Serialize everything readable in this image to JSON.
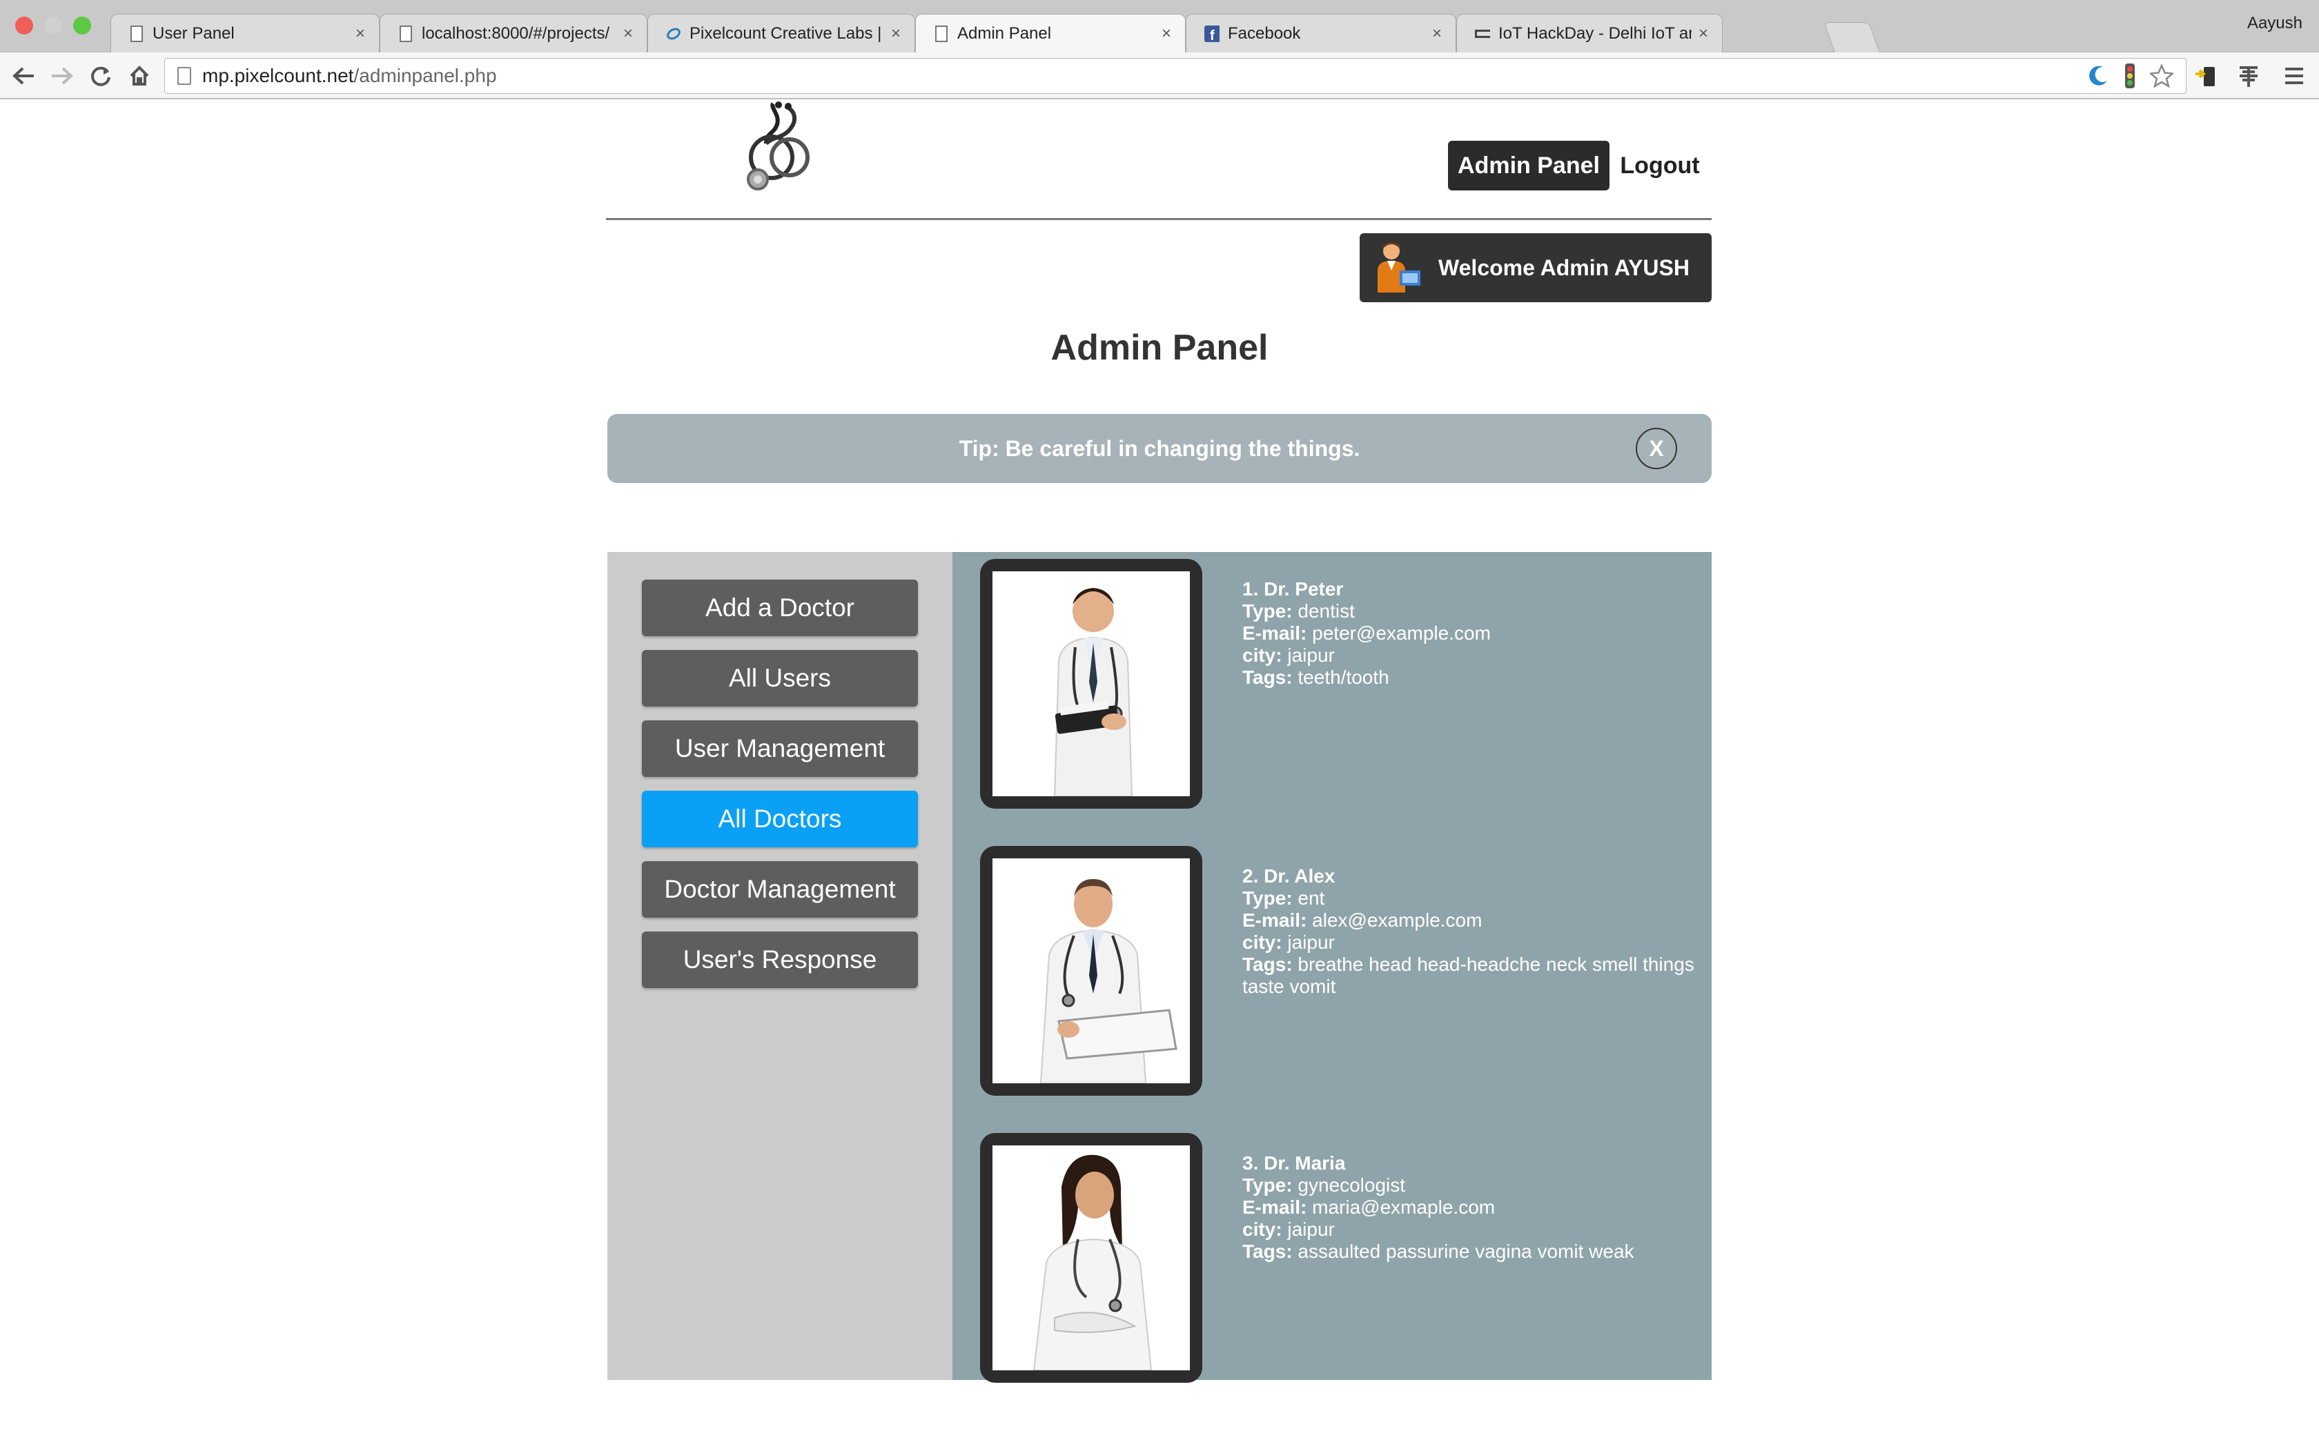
{
  "browser": {
    "tabs": [
      {
        "title": "User Panel",
        "active": false
      },
      {
        "title": "localhost:8000/#/projects/",
        "active": false
      },
      {
        "title": "Pixelcount Creative Labs |",
        "active": false
      },
      {
        "title": "Admin Panel",
        "active": true
      },
      {
        "title": "Facebook",
        "active": false
      },
      {
        "title": "IoT HackDay - Delhi IoT and",
        "active": false
      }
    ],
    "profile": "Aayush",
    "close_glyph": "×",
    "url_host": "mp.pixelcount.net",
    "url_path": "/adminpanel.php"
  },
  "header": {
    "admin_panel_button": "Admin Panel",
    "logout_link": "Logout"
  },
  "welcome": "Welcome Admin AYUSH",
  "page_title": "Admin Panel",
  "tip": {
    "text": "Tip: Be careful in changing the things.",
    "close_label": "X"
  },
  "sidebar": {
    "items": [
      {
        "label": "Add a Doctor",
        "active": false
      },
      {
        "label": "All Users",
        "active": false
      },
      {
        "label": "User Management",
        "active": false
      },
      {
        "label": "All Doctors",
        "active": true
      },
      {
        "label": "Doctor Management",
        "active": false
      },
      {
        "label": "User's Response",
        "active": false
      }
    ]
  },
  "field_labels": {
    "type": "Type:",
    "email": "E-mail:",
    "city": "city:",
    "tags": "Tags:"
  },
  "doctors": [
    {
      "heading": "1. Dr. Peter",
      "type": "dentist",
      "email": "peter@example.com",
      "city": "jaipur",
      "tags": "teeth/tooth"
    },
    {
      "heading": "2. Dr. Alex",
      "type": "ent",
      "email": "alex@example.com",
      "city": "jaipur",
      "tags": "breathe head head-headche neck smell things taste vomit"
    },
    {
      "heading": "3. Dr. Maria",
      "type": "gynecologist",
      "email": "maria@exmaple.com",
      "city": "jaipur",
      "tags": "assaulted passurine vagina vomit weak"
    }
  ],
  "colors": {
    "accent_active": "#0aa0f5",
    "sidebar_button": "#5e5e5e",
    "panel_bg": "#8fa4aa",
    "tip_bg": "#a7b3b9"
  }
}
